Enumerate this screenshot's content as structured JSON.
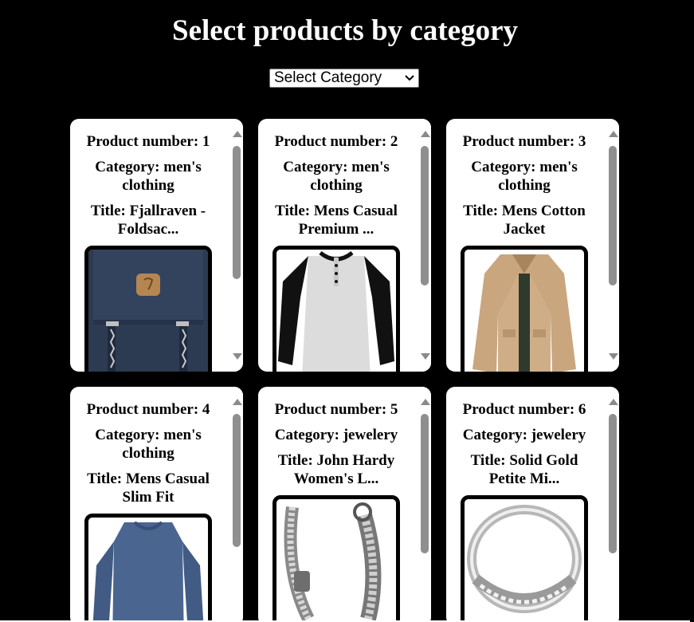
{
  "page": {
    "title": "Select products by category",
    "select": {
      "value": "Select Category"
    }
  },
  "labels": {
    "product_number_prefix": "Product number: ",
    "category_prefix": "Category: ",
    "title_prefix": "Title: "
  },
  "products": [
    {
      "number": "1",
      "category": "men's clothing",
      "title": "Fjallraven - Foldsac...",
      "image": "navy-backpack-image"
    },
    {
      "number": "2",
      "category": "men's clothing",
      "title": "Mens Casual Premium ...",
      "image": "raglan-tshirt-image"
    },
    {
      "number": "3",
      "category": "men's clothing",
      "title": "Mens Cotton Jacket",
      "image": "khaki-jacket-image"
    },
    {
      "number": "4",
      "category": "men's clothing",
      "title": "Mens Casual Slim Fit",
      "image": "blue-longsleeve-image"
    },
    {
      "number": "5",
      "category": "jewelery",
      "title": "John Hardy Women's L...",
      "image": "silver-chain-bracelet-image"
    },
    {
      "number": "6",
      "category": "jewelery",
      "title": "Solid Gold Petite Mi...",
      "image": "silver-ring-image"
    }
  ],
  "colors": {
    "background": "#000000",
    "card": "#ffffff",
    "scrollbar_thumb": "#8f8f8f"
  }
}
